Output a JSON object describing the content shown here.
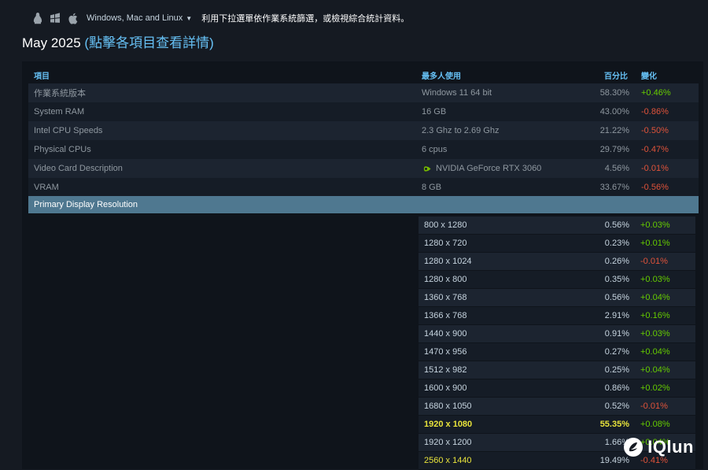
{
  "platform": {
    "selected": "Windows, Mac and Linux",
    "hint": "利用下拉選單依作業系統篩選，或檢視綜合統計資料。",
    "icons": [
      "linux-icon",
      "windows-icon",
      "apple-icon"
    ]
  },
  "page": {
    "title": "May 2025",
    "subtitle": "(點擊各項目查看詳情)"
  },
  "table": {
    "headers": {
      "item": "項目",
      "most": "最多人使用",
      "pct": "百分比",
      "change": "變化"
    },
    "rows": [
      {
        "item": "作業系統版本",
        "value": "Windows 11 64 bit",
        "pct": "58.30%",
        "change": "+0.46%",
        "dir": "pos"
      },
      {
        "item": "System RAM",
        "value": "16 GB",
        "pct": "43.00%",
        "change": "-0.86%",
        "dir": "neg"
      },
      {
        "item": "Intel CPU Speeds",
        "value": "2.3 Ghz to 2.69 Ghz",
        "pct": "21.22%",
        "change": "-0.50%",
        "dir": "neg"
      },
      {
        "item": "Physical CPUs",
        "value": "6 cpus",
        "pct": "29.79%",
        "change": "-0.47%",
        "dir": "neg"
      },
      {
        "item": "Video Card Description",
        "value": "NVIDIA GeForce RTX 3060",
        "pct": "4.56%",
        "change": "-0.01%",
        "dir": "neg",
        "icon": "nvidia-icon"
      },
      {
        "item": "VRAM",
        "value": "8 GB",
        "pct": "33.67%",
        "change": "-0.56%",
        "dir": "neg"
      }
    ],
    "section": "Primary Display Resolution",
    "resolutions": [
      {
        "res": "800 x 1280",
        "pct": "0.56%",
        "change": "+0.03%",
        "dir": "pos"
      },
      {
        "res": "1280 x 720",
        "pct": "0.23%",
        "change": "+0.01%",
        "dir": "pos"
      },
      {
        "res": "1280 x 1024",
        "pct": "0.26%",
        "change": "-0.01%",
        "dir": "neg"
      },
      {
        "res": "1280 x 800",
        "pct": "0.35%",
        "change": "+0.03%",
        "dir": "pos"
      },
      {
        "res": "1360 x 768",
        "pct": "0.56%",
        "change": "+0.04%",
        "dir": "pos"
      },
      {
        "res": "1366 x 768",
        "pct": "2.91%",
        "change": "+0.16%",
        "dir": "pos"
      },
      {
        "res": "1440 x 900",
        "pct": "0.91%",
        "change": "+0.03%",
        "dir": "pos"
      },
      {
        "res": "1470 x 956",
        "pct": "0.27%",
        "change": "+0.04%",
        "dir": "pos"
      },
      {
        "res": "1512 x 982",
        "pct": "0.25%",
        "change": "+0.04%",
        "dir": "pos"
      },
      {
        "res": "1600 x 900",
        "pct": "0.86%",
        "change": "+0.02%",
        "dir": "pos"
      },
      {
        "res": "1680 x 1050",
        "pct": "0.52%",
        "change": "-0.01%",
        "dir": "neg"
      },
      {
        "res": "1920 x 1080",
        "pct": "55.35%",
        "change": "+0.08%",
        "dir": "pos",
        "highlight": true
      },
      {
        "res": "1920 x 1200",
        "pct": "1.66%",
        "change": "+0.04%",
        "dir": "pos"
      },
      {
        "res": "2560 x 1440",
        "pct": "19.49%",
        "change": "-0.41%",
        "dir": "neg",
        "highlight2": true
      }
    ]
  },
  "watermark": {
    "text": "IQlun"
  },
  "colors": {
    "positive": "#66cc00",
    "negative": "#e0533a",
    "highlight": "#e8e33b",
    "section": "#4f7890",
    "link": "#66c0f4"
  }
}
